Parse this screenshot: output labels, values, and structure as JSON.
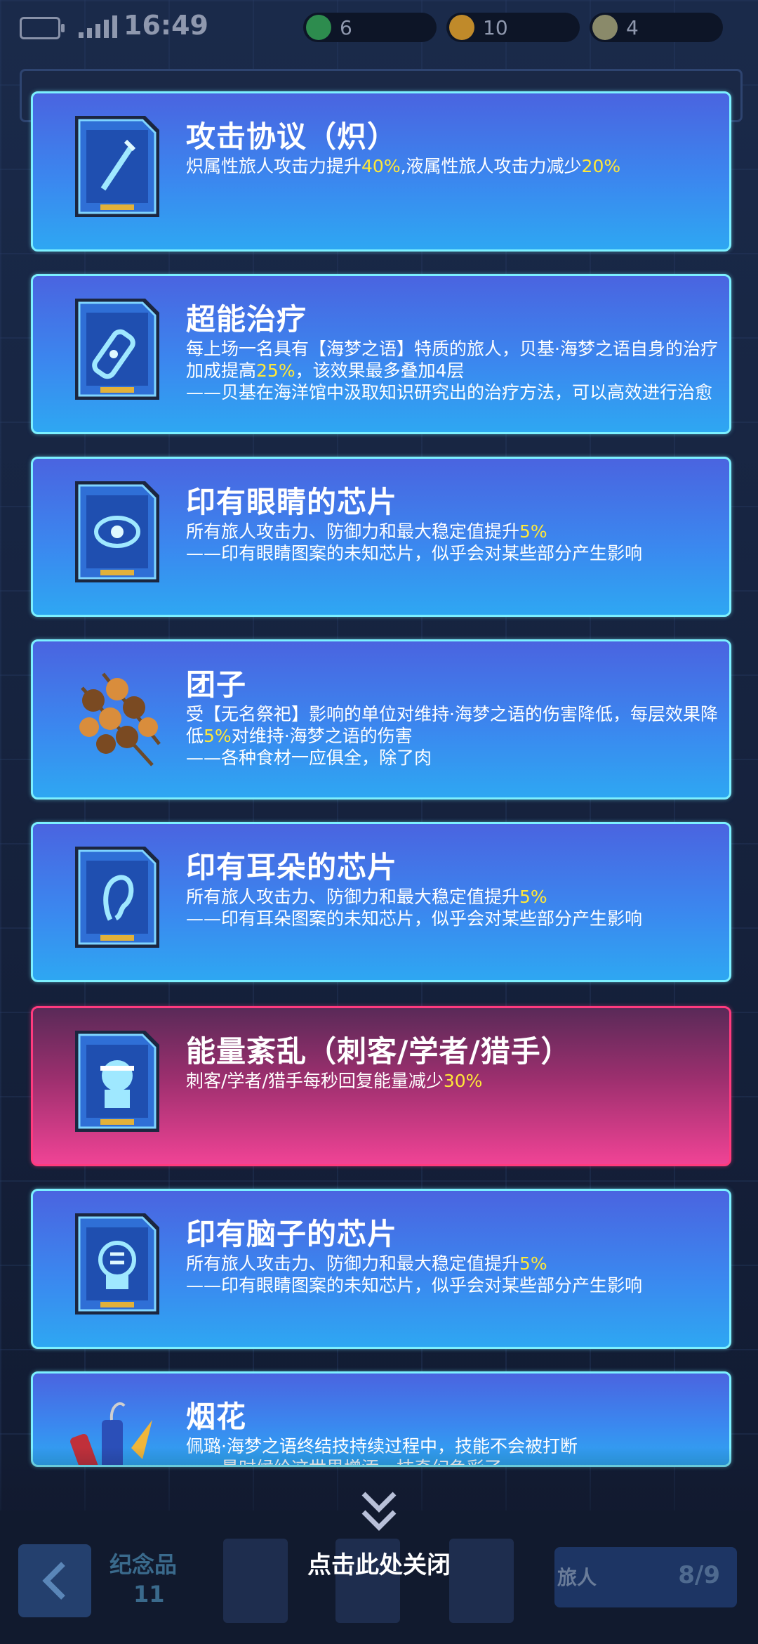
{
  "status": {
    "time": "16:49"
  },
  "resources": [
    {
      "value": "6",
      "color": "#2d8c4e"
    },
    {
      "value": "10",
      "color": "#c08a2a"
    },
    {
      "value": "4",
      "color": "#8a8a6a"
    }
  ],
  "cards": [
    {
      "title": "攻击协议（炽）",
      "desc_parts": [
        [
          "炽属性旅人攻击力提升",
          ""
        ],
        [
          "40%",
          "hl"
        ],
        [
          ",液属性旅人攻击力减少",
          ""
        ],
        [
          "20%",
          "hl"
        ]
      ],
      "icon": "chip-sword-icon"
    },
    {
      "title": "超能治疗",
      "desc_parts": [
        [
          "每上场一名具有【海梦之语】特质的旅人，贝基·海梦之语自身的治疗加成提高",
          ""
        ],
        [
          "25%",
          "hl"
        ],
        [
          "，该效果最多叠加4层\n——贝基在海洋馆中汲取知识研究出的治疗方法，可以高效进行治愈",
          ""
        ]
      ],
      "icon": "chip-bandage-icon"
    },
    {
      "title": "印有眼睛的芯片",
      "desc_parts": [
        [
          "所有旅人攻击力、防御力和最大稳定值提升",
          ""
        ],
        [
          "5%",
          "hl"
        ],
        [
          "\n——印有眼睛图案的未知芯片，似乎会对某些部分产生影响",
          ""
        ]
      ],
      "icon": "chip-eye-icon"
    },
    {
      "title": "团子",
      "desc_parts": [
        [
          "受【无名祭祀】影响的单位对维持·海梦之语的伤害降低，每层效果降低",
          ""
        ],
        [
          "5%",
          "hl"
        ],
        [
          "对维持·海梦之语的伤害\n——各种食材一应俱全，除了肉",
          ""
        ]
      ],
      "icon": "dango-icon"
    },
    {
      "title": "印有耳朵的芯片",
      "desc_parts": [
        [
          "所有旅人攻击力、防御力和最大稳定值提升",
          ""
        ],
        [
          "5%",
          "hl"
        ],
        [
          "\n——印有耳朵图案的未知芯片，似乎会对某些部分产生影响",
          ""
        ]
      ],
      "icon": "chip-ear-icon"
    },
    {
      "title": "能量紊乱（刺客/学者/猎手）",
      "desc_parts": [
        [
          "刺客/学者/猎手每秒回复能量减少",
          ""
        ],
        [
          "30%",
          "hl"
        ]
      ],
      "icon": "chip-head-icon",
      "style": "pink"
    },
    {
      "title": "印有脑子的芯片",
      "desc_parts": [
        [
          "所有旅人攻击力、防御力和最大稳定值提升",
          ""
        ],
        [
          "5%",
          "hl"
        ],
        [
          "\n——印有眼睛图案的未知芯片，似乎会对某些部分产生影响",
          ""
        ]
      ],
      "icon": "chip-brain-icon"
    },
    {
      "title": "烟花",
      "desc_parts": [
        [
          "佩璐·海梦之语终结技持续过程中，技能不会被打断\n——最时候给这世界增添一抹奇幻色彩了",
          ""
        ]
      ],
      "icon": "firework-icon"
    }
  ],
  "bottom": {
    "souvenir_label": "纪念品",
    "souvenir_count": "11",
    "traveler_label": "旅人",
    "traveler_count": "8/9",
    "close_hint": "点击此处关闭"
  }
}
